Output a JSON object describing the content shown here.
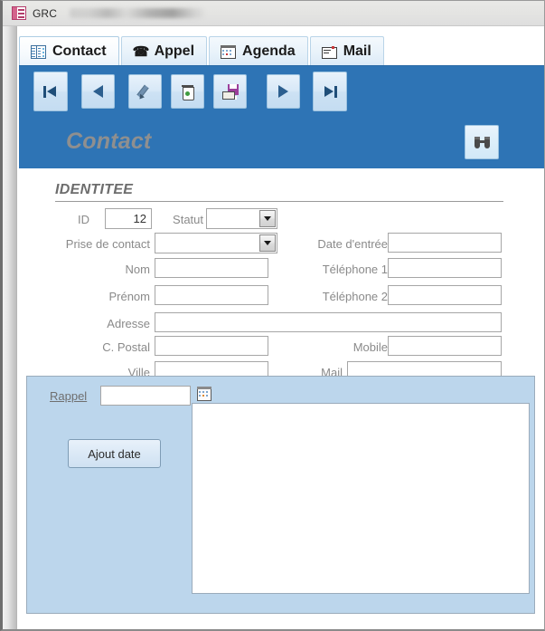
{
  "window": {
    "title": "GRC",
    "icon": "access-form-icon"
  },
  "tabs": [
    {
      "label": "Contact",
      "icon": "contact-form-icon",
      "active": true
    },
    {
      "label": "Appel",
      "icon": "phone-icon",
      "active": false
    },
    {
      "label": "Agenda",
      "icon": "calendar-icon",
      "active": false
    },
    {
      "label": "Mail",
      "icon": "envelope-icon",
      "active": false
    }
  ],
  "toolbar": {
    "buttons": [
      {
        "name": "first-record",
        "icon": "skip-to-first-icon"
      },
      {
        "name": "previous-record",
        "icon": "triangle-left-icon"
      },
      {
        "name": "edit-record",
        "icon": "pencil-icon"
      },
      {
        "name": "delete-record",
        "icon": "trash-icon"
      },
      {
        "name": "save-record",
        "icon": "floppy-save-icon"
      },
      {
        "name": "next-record",
        "icon": "triangle-right-icon"
      },
      {
        "name": "last-record",
        "icon": "skip-to-last-icon"
      }
    ]
  },
  "section": {
    "title": "Contact",
    "find_icon": "binoculars-icon"
  },
  "form": {
    "group_header": "IDENTITEE",
    "fields": {
      "id": {
        "label": "ID",
        "value": "12"
      },
      "statut": {
        "label": "Statut",
        "value": ""
      },
      "date_entree": {
        "label": "Date d'entrée",
        "value": ""
      },
      "prise_contact": {
        "label": "Prise de contact",
        "value": ""
      },
      "nom": {
        "label": "Nom",
        "value": ""
      },
      "telephone1": {
        "label": "Téléphone 1",
        "value": ""
      },
      "prenom": {
        "label": "Prénom",
        "value": ""
      },
      "telephone2": {
        "label": "Téléphone 2",
        "value": ""
      },
      "adresse": {
        "label": "Adresse",
        "value": ""
      },
      "code_postal": {
        "label": "C. Postal",
        "value": ""
      },
      "mobile": {
        "label": "Mobile",
        "value": ""
      },
      "ville": {
        "label": "Ville",
        "value": ""
      },
      "mail": {
        "label": "Mail",
        "value": ""
      }
    }
  },
  "rappel_panel": {
    "label": "Rappel",
    "date_value": "",
    "date_picker_icon": "calendar-picker-icon",
    "add_date_label": "Ajout date",
    "notes_value": ""
  },
  "colors": {
    "band_blue": "#2e74b5",
    "panel_blue": "#bcd6ec",
    "tab_blue": "#e8f2fa",
    "label_gray": "#8a8a8a",
    "title_gray": "#8f8f8f"
  }
}
